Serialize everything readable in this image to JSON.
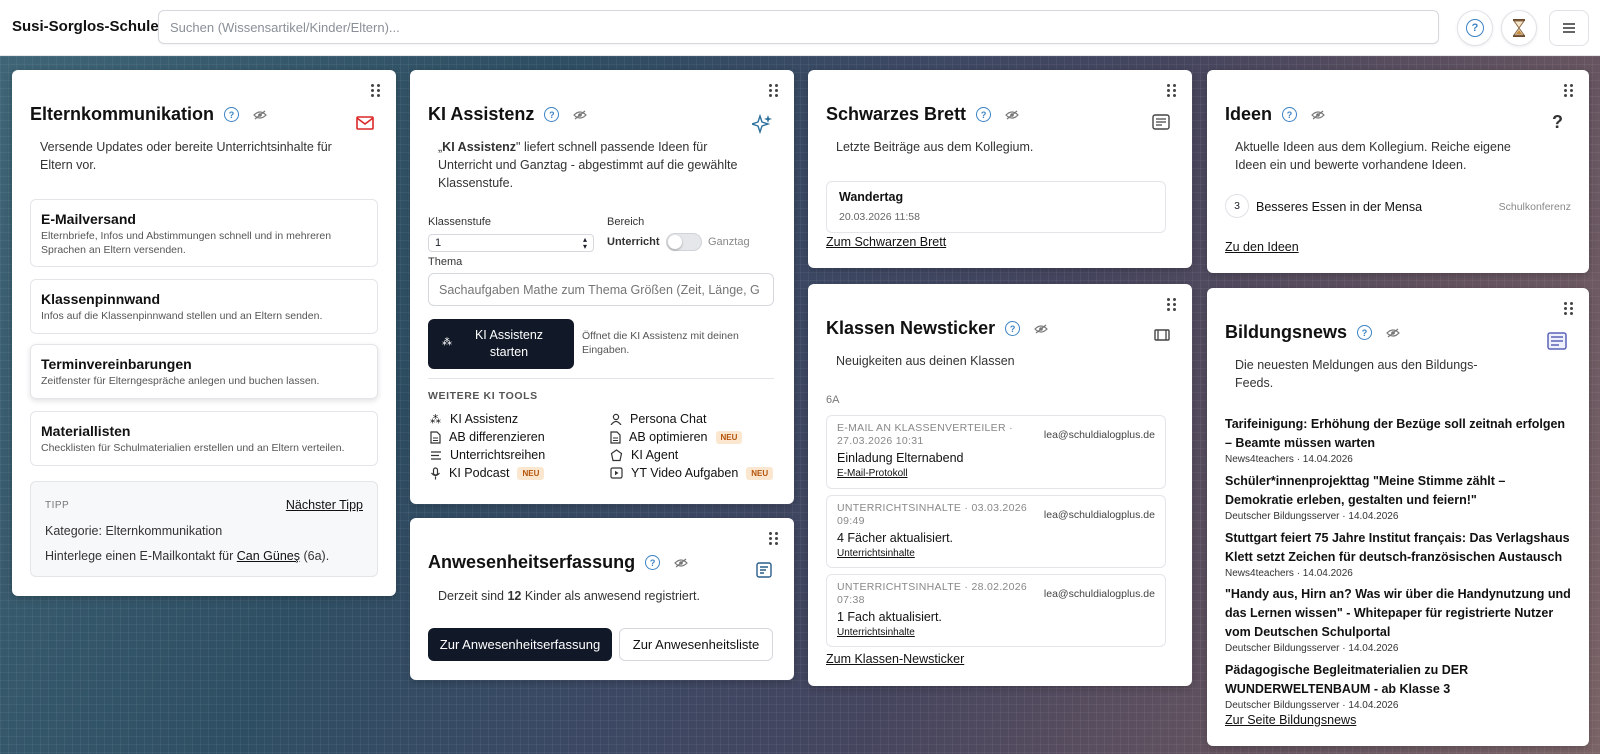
{
  "app": {
    "brand": "Susi-Sorglos-Schule"
  },
  "search": {
    "placeholder": "Suchen (Wissensartikel/Kinder/Eltern)..."
  },
  "header": {
    "help_icon": "question-circle-icon",
    "timer_icon": "hourglass-icon",
    "menu_icon": "menu-icon"
  },
  "eltern": {
    "title": "Elternkommunikation",
    "desc": "Versende Updates oder bereite Unterrichtsinhalte für Eltern vor.",
    "options": [
      {
        "title": "E-Mailversand",
        "sub": "Elternbriefe, Infos und Abstimmungen schnell und in mehreren Sprachen an Eltern versenden."
      },
      {
        "title": "Klassenpinnwand",
        "sub": "Infos auf die Klassenpinnwand stellen und an Eltern senden."
      },
      {
        "title": "Terminvereinbarungen",
        "sub": "Zeitfenster für Elterngespräche anlegen und buchen lassen."
      },
      {
        "title": "Materiallisten",
        "sub": "Checklisten für Schulmaterialien erstellen und an Eltern verteilen."
      }
    ],
    "tip": {
      "label": "TIPP",
      "next": "Nächster Tipp",
      "category": "Kategorie: Elternkommunikation",
      "text_pre": "Hinterlege einen E-Mailkontakt für ",
      "text_link": "Can Güneş",
      "text_post": " (6a)."
    }
  },
  "ki": {
    "title": "KI Assistenz",
    "desc_open": "„",
    "desc_bold": "KI Assistenz",
    "desc_rest": "\" liefert schnell passende Ideen für Unterricht und Ganztag - abgestimmt auf die gewählte Klassenstufe.",
    "klassenstufe_label": "Klassenstufe",
    "klassenstufe_value": "1",
    "bereich_label": "Bereich",
    "bereich_on": "Unterricht",
    "bereich_off": "Ganztag",
    "thema_label": "Thema",
    "thema_placeholder": "Sachaufgaben Mathe zum Thema Größen (Zeit, Länge, G",
    "start_button": "KI Assistenz starten",
    "start_hint": "Öffnet die KI Assistenz mit deinen Eingaben.",
    "tools_heading": "WEITERE KI TOOLS",
    "tools": [
      {
        "label": "KI Assistenz",
        "icon": "sparkles-icon",
        "neu": ""
      },
      {
        "label": "Persona Chat",
        "icon": "person-icon",
        "neu": ""
      },
      {
        "label": "AB differenzieren",
        "icon": "document-icon",
        "neu": ""
      },
      {
        "label": "AB optimieren",
        "icon": "document-icon",
        "neu": "NEU"
      },
      {
        "label": "Unterrichtsreihen",
        "icon": "list-icon",
        "neu": ""
      },
      {
        "label": "KI Agent",
        "icon": "agent-icon",
        "neu": ""
      },
      {
        "label": "KI Podcast",
        "icon": "microphone-icon",
        "neu": "NEU"
      },
      {
        "label": "YT Video Aufgaben",
        "icon": "video-icon",
        "neu": "NEU"
      }
    ]
  },
  "anwesenheit": {
    "title": "Anwesenheitserfassung",
    "desc_pre": "Derzeit sind ",
    "desc_count": "12",
    "desc_post": " Kinder als anwesend registriert.",
    "btn_primary": "Zur Anwesenheitserfassung",
    "btn_secondary": "Zur Anwesenheitsliste"
  },
  "brett": {
    "title": "Schwarzes Brett",
    "desc": "Letzte Beiträge aus dem Kollegium.",
    "post_title": "Wandertag",
    "post_date": "20.03.2026 11:58",
    "link": "Zum Schwarzen Brett"
  },
  "ticker": {
    "title": "Klassen Newsticker",
    "desc": "Neuigkeiten aus deinen Klassen",
    "class_label": "6A",
    "items": [
      {
        "meta": "E-MAIL AN KLASSENVERTEILER · 27.03.2026 10:31",
        "mail": "lea@schuldialogplus.de",
        "body": "Einladung Elternabend",
        "sub": "E-Mail-Protokoll"
      },
      {
        "meta": "UNTERRICHTSINHALTE · 03.03.2026 09:49",
        "mail": "lea@schuldialogplus.de",
        "body": "4 Fächer aktualisiert.",
        "sub": "Unterrichtsinhalte"
      },
      {
        "meta": "UNTERRICHTSINHALTE · 28.02.2026 07:38",
        "mail": "lea@schuldialogplus.de",
        "body": "1 Fach aktualisiert.",
        "sub": "Unterrichtsinhalte"
      }
    ],
    "link": "Zum Klassen-Newsticker"
  },
  "ideen": {
    "title": "Ideen",
    "desc": "Aktuelle Ideen aus dem Kollegium. Reiche eigene Ideen ein und bewerte vorhandene Ideen.",
    "idea_count": "3",
    "idea_title": "Besseres Essen in der Mensa",
    "idea_tag": "Schulkonferenz",
    "link": "Zu den Ideen"
  },
  "bildung": {
    "title": "Bildungsnews",
    "desc": "Die neuesten Meldungen aus den Bildungs-Feeds.",
    "items": [
      {
        "title": "Tarifeinigung: Erhöhung der Bezüge soll zeitnah erfolgen – Beamte müssen warten",
        "meta": "News4teachers · 14.04.2026"
      },
      {
        "title": "Schüler*innenprojekttag \"Meine Stimme zählt – Demokratie erleben, gestalten und feiern!\"",
        "meta": "Deutscher Bildungsserver · 14.04.2026"
      },
      {
        "title": "Stuttgart feiert 75 Jahre Institut français: Das Verlagshaus Klett setzt Zeichen für deutsch-französischen Austausch",
        "meta": "News4teachers · 14.04.2026"
      },
      {
        "title": "\"Handy aus, Hirn an? Was wir über die Handynutzung und das Lernen wissen\" - Whitepaper für registrierte Nutzer vom Deutschen Schulportal",
        "meta": "Deutscher Bildungsserver · 14.04.2026"
      },
      {
        "title": "Pädagogische Begleitmaterialien zu DER WUNDERWELTENBAUM - ab Klasse 3",
        "meta": "Deutscher Bildungsserver · 14.04.2026"
      }
    ],
    "link": "Zur Seite Bildungsnews"
  },
  "colors": {
    "accent_blue": "#3b82c4",
    "mail_red": "#dc2626",
    "dark_button": "#111827",
    "neu_badge": "#fbe7cf"
  }
}
